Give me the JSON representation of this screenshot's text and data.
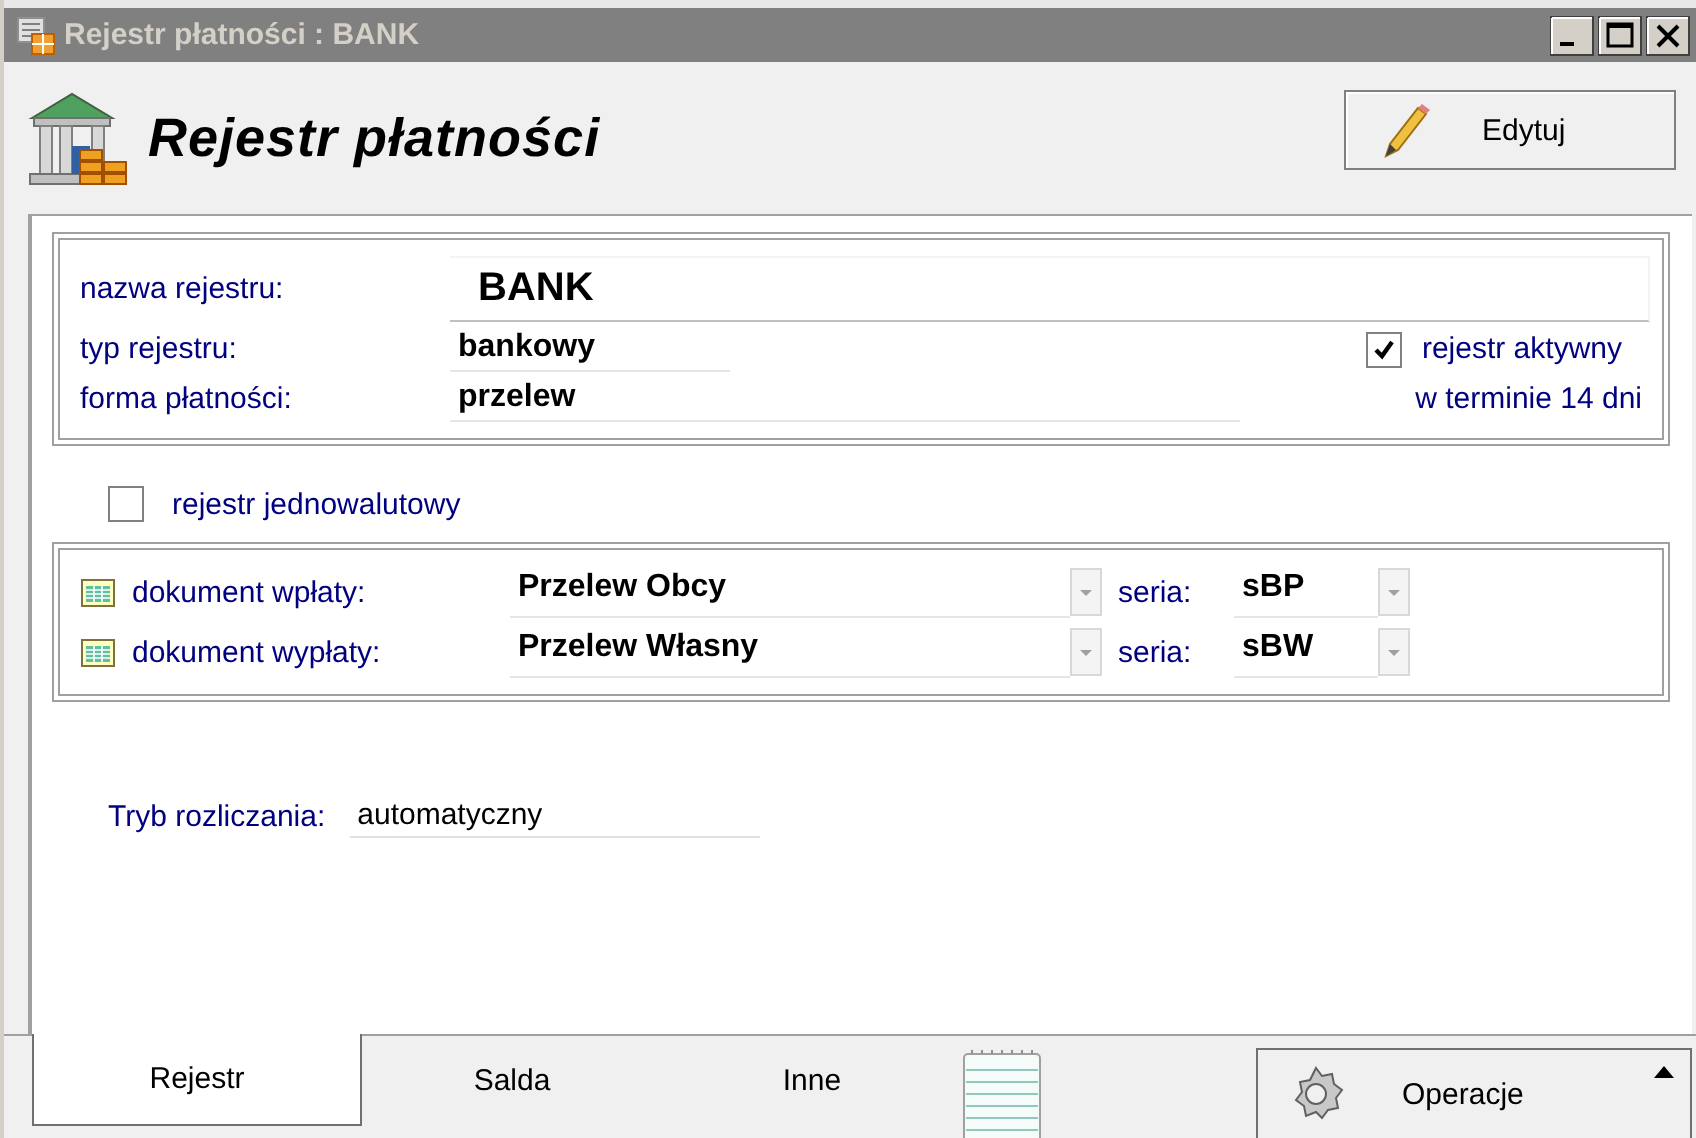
{
  "window": {
    "title": "Rejestr płatności : BANK"
  },
  "header": {
    "title": "Rejestr płatności",
    "edit_button": "Edytuj"
  },
  "details": {
    "fields": [
      {
        "label": "nazwa rejestru:",
        "value": "BANK"
      },
      {
        "label": "typ rejestru:",
        "value": "bankowy"
      },
      {
        "label": "forma płatności:",
        "value": "przelew"
      }
    ],
    "active": {
      "label": "rejestr aktywny",
      "checked": true
    },
    "term": "w terminie 14 dni"
  },
  "single_currency": {
    "label": "rejestr jednowalutowy",
    "checked": false
  },
  "documents": [
    {
      "label": "dokument wpłaty:",
      "value": "Przelew Obcy",
      "series_label": "seria:",
      "series": "sBP"
    },
    {
      "label": "dokument wypłaty:",
      "value": "Przelew Własny",
      "series_label": "seria:",
      "series": "sBW"
    }
  ],
  "settlement": {
    "label": "Tryb rozliczania:",
    "value": "automatyczny"
  },
  "tabs": [
    {
      "label": "Rejestr",
      "selected": true
    },
    {
      "label": "Salda",
      "selected": false
    },
    {
      "label": "Inne",
      "selected": false
    }
  ],
  "operations_button": "Operacje"
}
